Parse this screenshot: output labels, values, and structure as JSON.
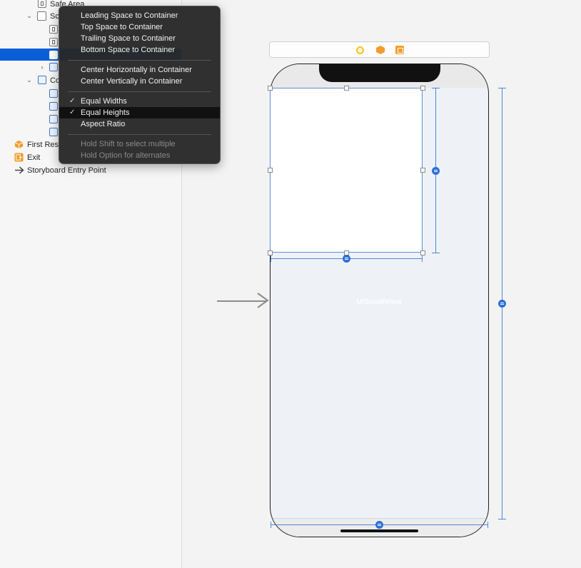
{
  "outline": {
    "rows": [
      {
        "label": "Safe Area"
      },
      {
        "label": "Sc"
      },
      {
        "label": ""
      },
      {
        "label": ""
      },
      {
        "label": ""
      },
      {
        "label": ""
      },
      {
        "label": "Co"
      },
      {
        "label": ""
      },
      {
        "label": ""
      },
      {
        "label": ""
      },
      {
        "label": ""
      },
      {
        "label": "First Res"
      },
      {
        "label": "Exit"
      },
      {
        "label": "Storyboard Entry Point"
      }
    ]
  },
  "menu": {
    "group1": [
      "Leading Space to Container",
      "Top Space to Container",
      "Trailing Space to Container",
      "Bottom Space to Container"
    ],
    "group2": [
      "Center Horizontally in Container",
      "Center Vertically in Container"
    ],
    "group3": [
      {
        "label": "Equal Widths",
        "checked": true,
        "highlighted": false
      },
      {
        "label": "Equal Heights",
        "checked": true,
        "highlighted": true
      },
      {
        "label": "Aspect Ratio",
        "checked": false,
        "highlighted": false
      }
    ],
    "hints": [
      "Hold Shift to select multiple",
      "Hold Option for alternates"
    ],
    "check_glyph": "✓"
  },
  "canvas": {
    "scroll_view_label": "UIScrollView"
  },
  "colors": {
    "selection": "#0a5fd7",
    "constraint": "#4f86d9",
    "menu_bg": "#282828",
    "accent_orange": "#f29d2b"
  }
}
